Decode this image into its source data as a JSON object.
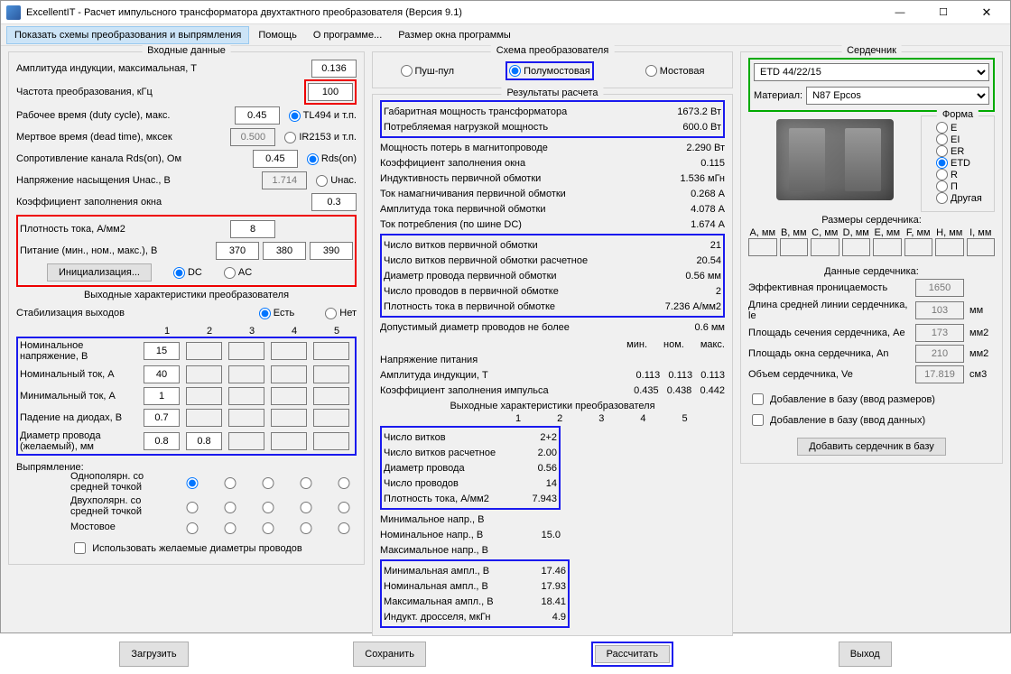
{
  "window": {
    "title": "ExcellentIT - Расчет импульсного трансформатора двухтактного преобразователя (Версия 9.1)"
  },
  "menu": {
    "show_schemes": "Показать схемы преобразования и выпрямления",
    "help": "Помощь",
    "about": "О программе...",
    "winsize": "Размер окна программы"
  },
  "group": {
    "input": "Входные данные",
    "outputs_hdr": "Выходные характеристики преобразователя",
    "scheme": "Схема преобразователя",
    "results": "Результаты расчета",
    "core_hdr": "Сердечник",
    "forma": "Форма",
    "dims": "Размеры сердечника:",
    "core_data": "Данные сердечника:"
  },
  "labels": {
    "bmax": "Амплитуда индукции, максимальная, T",
    "freq": "Частота преобразования, кГц",
    "duty": "Рабочее время (duty cycle), макс.",
    "dead": "Мертвое время (dead time), мксек",
    "rds": "Сопротивление канала Rds(on), Ом",
    "usat": "Напряжение насыщения Uнас., B",
    "kwin": "Коэффициент заполнения окна",
    "jden": "Плотность тока, А/мм2",
    "supply": "Питание (мин., ном., макс.), В",
    "init_btn": "Инициализация...",
    "tl494": "TL494 и т.п.",
    "ir2153": "IR2153 и т.п.",
    "rdson": "Rds(on)",
    "usat_r": "Uнас.",
    "dc": "DC",
    "ac": "AC",
    "stab": "Стабилизация выходов",
    "yes": "Есть",
    "no": "Нет",
    "vnom": "Номинальное напряжение, В",
    "inom": "Номинальный ток, А",
    "imin": "Минимальный ток, А",
    "vdrop": "Падение на диодах, В",
    "dwire": "Диаметр провода (желаемый), мм",
    "rect_lbl": "Выпрямление:",
    "rect1": "Однополярн. со средней точкой",
    "rect2": "Двухполярн. со средней точкой",
    "rect3": "Мостовое",
    "use_dia": "Использовать желаемые диаметры проводов",
    "pushpull": "Пуш-пул",
    "halfbridge": "Полумостовая",
    "bridge": "Мостовая",
    "outputs_sub": "Выходные характеристики преобразователя",
    "core_sel_placeholder": "ETD 44/22/15",
    "material_lbl": "Материал:",
    "material_val": "N87 Epcos",
    "eff_perm": "Эффективная проницаемость",
    "le": "Длина средней линии сердечника, le",
    "ae": "Площадь сечения сердечника, Ae",
    "an": "Площадь окна сердечника, An",
    "ve": "Объем сердечника, Ve",
    "add_dims": "Добавление в базу (ввод размеров)",
    "add_data": "Добавление в базу (ввод данных)",
    "add_btn": "Добавить сердечник в базу",
    "load": "Загрузить",
    "save": "Сохранить",
    "calc": "Рассчитать",
    "exit": "Выход"
  },
  "values": {
    "bmax": "0.136",
    "freq": "100",
    "duty": "0.45",
    "dead": "0.500",
    "rds": "0.45",
    "usat": "1.714",
    "kwin": "0.3",
    "jden": "8",
    "vmin": "370",
    "vnom": "380",
    "vmax": "390",
    "out": {
      "v": [
        "15",
        "",
        "",
        "",
        ""
      ],
      "i": [
        "40",
        "",
        "",
        "",
        ""
      ],
      "imin": [
        "1",
        "",
        "",
        "",
        ""
      ],
      "vd": [
        "0.7",
        "",
        "",
        "",
        ""
      ],
      "d": [
        "0.8",
        "0.8",
        "",
        "",
        ""
      ]
    }
  },
  "results": {
    "r1": [
      [
        "Габаритная мощность трансформатора",
        "1673.2 Вт"
      ],
      [
        "Потребляемая нагрузкой мощность",
        "600.0 Вт"
      ]
    ],
    "r2": [
      [
        "Мощность потерь в магнитопроводе",
        "2.290 Вт"
      ],
      [
        "Коэффициент заполнения окна",
        "0.115"
      ],
      [
        "Индуктивность первичной обмотки",
        "1.536 мГн"
      ],
      [
        "Ток намагничивания первичной обмотки",
        "0.268 А"
      ],
      [
        "Амплитуда тока первичной обмотки",
        "4.078 А"
      ],
      [
        "Ток потребления (по шине DC)",
        "1.674 А"
      ]
    ],
    "r3": [
      [
        "Число витков первичной обмотки",
        "21"
      ],
      [
        "Число витков первичной обмотки расчетное",
        "20.54"
      ],
      [
        "Диаметр провода первичной обмотки",
        "0.56 мм"
      ],
      [
        "Число проводов в первичной обмотке",
        "2"
      ],
      [
        "Плотность тока в первичной обмотке",
        "7.236 А/мм2"
      ]
    ],
    "r4": [
      [
        "Допустимый диаметр проводов не более",
        "0.6 мм"
      ]
    ],
    "minnommax_hdr": [
      "мин.",
      "ном.",
      "макс."
    ],
    "r5": [
      [
        "Напряжение питания",
        ""
      ],
      [
        "Амплитуда индукции, T",
        "0.113   0.113   0.113"
      ],
      [
        "Коэффициент заполнения импульса",
        "0.435   0.438   0.442"
      ]
    ],
    "out_cols": [
      "1",
      "2",
      "3",
      "4",
      "5"
    ],
    "out_block": [
      [
        "Число витков",
        "2+2"
      ],
      [
        "Число витков расчетное",
        "2.00"
      ],
      [
        "Диаметр провода",
        "0.56"
      ],
      [
        "Число проводов",
        "14"
      ],
      [
        "Плотность тока, А/мм2",
        "7.943"
      ]
    ],
    "r7": [
      [
        "Минимальное напр., В",
        ""
      ],
      [
        "Номинальное напр., В",
        "15.0"
      ],
      [
        "Максимальное напр., В",
        ""
      ]
    ],
    "r8": [
      [
        "Минимальная ампл., В",
        "17.46"
      ],
      [
        "Номинальная ампл., В",
        "17.93"
      ],
      [
        "Максимальная ампл., В",
        "18.41"
      ],
      [
        "Индукт. дросселя, мкГн",
        "4.9"
      ]
    ]
  },
  "forma": [
    "E",
    "EI",
    "ER",
    "ETD",
    "R",
    "П",
    "Другая"
  ],
  "forma_sel": "ETD",
  "dims_hdr": [
    "A, мм",
    "B, мм",
    "C, мм",
    "D, мм",
    "E, мм",
    "F, мм",
    "H, мм",
    "I, мм"
  ],
  "core_data": {
    "mu": "1650",
    "le": "103",
    "ae": "173",
    "an": "210",
    "ve": "17.819",
    "u_le": "мм",
    "u_ae": "мм2",
    "u_an": "мм2",
    "u_ve": "см3"
  }
}
